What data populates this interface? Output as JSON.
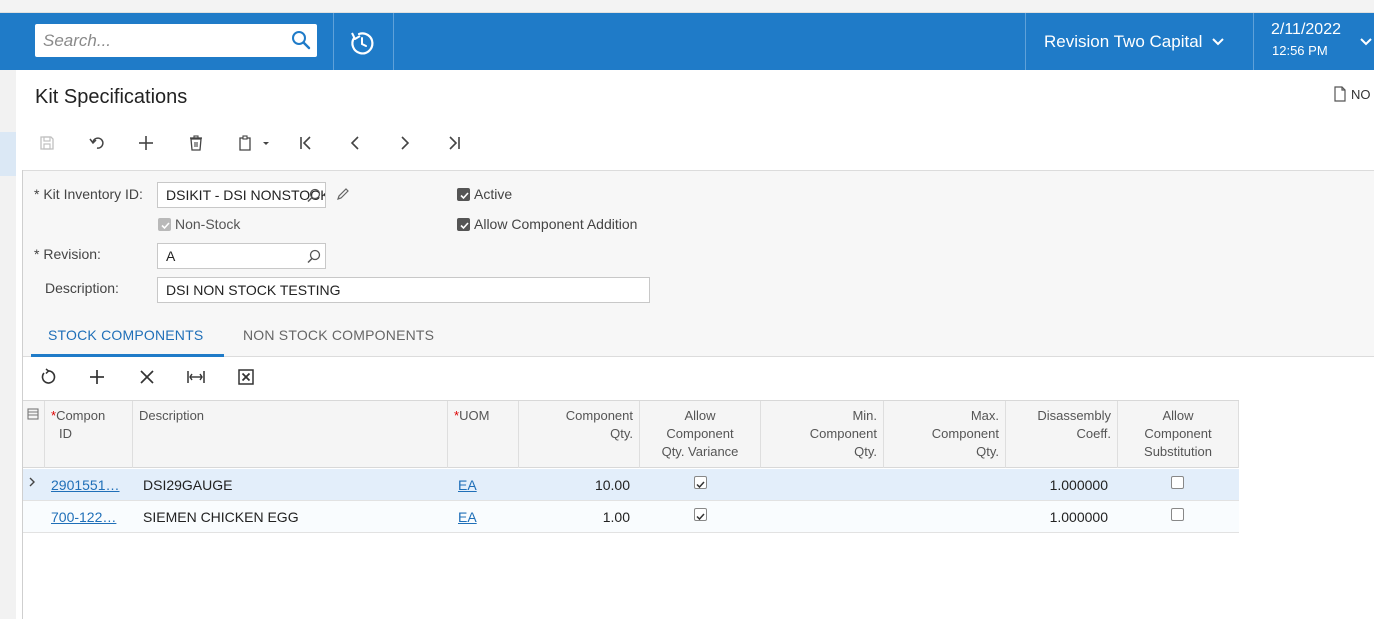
{
  "header": {
    "search_placeholder": "Search...",
    "company": "Revision Two Capital",
    "date": "2/11/2022",
    "time": "12:56 PM"
  },
  "page": {
    "title": "Kit Specifications",
    "notes_label": "NO"
  },
  "form": {
    "kit_inventory_id_label": "Kit Inventory ID:",
    "kit_inventory_id_value": "DSIKIT - DSI NONSTOCK",
    "non_stock_label": "Non-Stock",
    "non_stock_checked": true,
    "revision_label": "Revision:",
    "revision_value": "A",
    "description_label": "Description:",
    "description_value": "DSI NON STOCK TESTING",
    "active_label": "Active",
    "active_checked": true,
    "allow_component_addition_label": "Allow Component Addition",
    "allow_component_addition_checked": true
  },
  "tabs": [
    {
      "label": "STOCK COMPONENTS",
      "active": true
    },
    {
      "label": "NON STOCK COMPONENTS",
      "active": false
    }
  ],
  "grid": {
    "columns": {
      "component_id_1": "Compon",
      "component_id_2": "ID",
      "description": "Description",
      "uom": "UOM",
      "component_qty_1": "Component",
      "component_qty_2": "Qty.",
      "allow_qty_var_1": "Allow",
      "allow_qty_var_2": "Component",
      "allow_qty_var_3": "Qty. Variance",
      "min_qty_1": "Min.",
      "min_qty_2": "Component",
      "min_qty_3": "Qty.",
      "max_qty_1": "Max.",
      "max_qty_2": "Component",
      "max_qty_3": "Qty.",
      "disassembly_1": "Disassembly",
      "disassembly_2": "Coeff.",
      "allow_sub_1": "Allow",
      "allow_sub_2": "Component",
      "allow_sub_3": "Substitution"
    },
    "rows": [
      {
        "component_id": "2901551…",
        "description": "DSI29GAUGE",
        "uom": "EA",
        "qty": "10.00",
        "allow_variance": true,
        "min_qty": "",
        "max_qty": "",
        "disassembly_coeff": "1.000000",
        "allow_substitution": false
      },
      {
        "component_id": "700-122…",
        "description": "SIEMEN CHICKEN EGG",
        "uom": "EA",
        "qty": "1.00",
        "allow_variance": true,
        "min_qty": "",
        "max_qty": "",
        "disassembly_coeff": "1.000000",
        "allow_substitution": false
      }
    ]
  }
}
